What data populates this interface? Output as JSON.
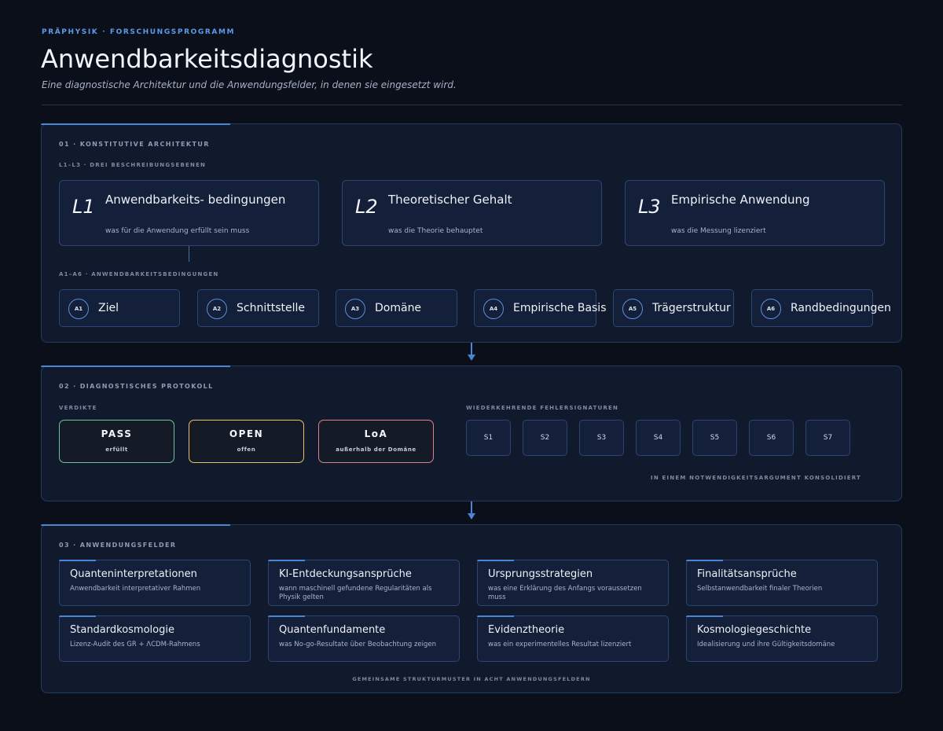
{
  "header": {
    "eyebrow": "PRÄPHYSIK · FORSCHUNGSPROGRAMM",
    "title": "Anwendbarkeitsdiagnostik",
    "subtitle": "Eine diagnostische Architektur und die Anwendungsfelder, in denen sie eingesetzt wird."
  },
  "section1": {
    "label": "01 · KONSTITUTIVE ARCHITEKTUR",
    "levels_label": "L1–L3 · DREI BESCHREIBUNGSEBENEN",
    "levels": [
      {
        "id": "L1",
        "name": "Anwendbarkeits- bedingungen",
        "desc": "was für die Anwendung erfüllt sein muss"
      },
      {
        "id": "L2",
        "name": "Theoretischer Gehalt",
        "desc": "was die Theorie behauptet"
      },
      {
        "id": "L3",
        "name": "Empirische Anwendung",
        "desc": "was die Messung lizenziert"
      }
    ],
    "conditions_label": "A1–A6 · ANWENDBARKEITSBEDINGUNGEN",
    "conditions": [
      {
        "id": "A1",
        "name": "Ziel"
      },
      {
        "id": "A2",
        "name": "Schnittstelle"
      },
      {
        "id": "A3",
        "name": "Domäne"
      },
      {
        "id": "A4",
        "name": "Empirische Basis"
      },
      {
        "id": "A5",
        "name": "Trägerstruktur"
      },
      {
        "id": "A6",
        "name": "Randbedingungen"
      }
    ]
  },
  "section2": {
    "label": "02 · DIAGNOSTISCHES PROTOKOLL",
    "verdicts_label": "VERDIKTE",
    "verdicts": [
      {
        "name": "PASS",
        "desc": "erfüllt",
        "color": "#6fc49a"
      },
      {
        "name": "OPEN",
        "desc": "offen",
        "color": "#e8c265"
      },
      {
        "name": "LoA",
        "desc": "außerhalb der Domäne",
        "color": "#e07f8a"
      }
    ],
    "signatures_label": "WIEDERKEHRENDE FEHLERSIGNATUREN",
    "signatures": [
      "S1",
      "S2",
      "S3",
      "S4",
      "S5",
      "S6",
      "S7"
    ],
    "signatures_note": "IN EINEM NOTWENDIGKEITSARGUMENT KONSOLIDIERT"
  },
  "section3": {
    "label": "03 · ANWENDUNGSFELDER",
    "fields": [
      {
        "name": "Quanteninterpretationen",
        "desc": "Anwendbarkeit interpretativer Rahmen"
      },
      {
        "name": "KI-Entdeckungsansprüche",
        "desc": "wann maschinell gefundene Regularitäten als Physik gelten"
      },
      {
        "name": "Ursprungsstrategien",
        "desc": "was eine Erklärung des Anfangs voraussetzen muss"
      },
      {
        "name": "Finalitätsansprüche",
        "desc": "Selbstanwendbarkeit finaler Theorien"
      },
      {
        "name": "Standardkosmologie",
        "desc": "Lizenz-Audit des GR + ΛCDM-Rahmens"
      },
      {
        "name": "Quantenfundamente",
        "desc": "was No-go-Resultate über Beobachtung zeigen"
      },
      {
        "name": "Evidenztheorie",
        "desc": "was ein experimentelles Resultat lizenziert"
      },
      {
        "name": "Kosmologiegeschichte",
        "desc": "Idealisierung und ihre Gültigkeitsdomäne"
      }
    ],
    "note": "GEMEINSAME STRUKTURMUSTER IN ACHT ANWENDUNGSFELDERN"
  }
}
